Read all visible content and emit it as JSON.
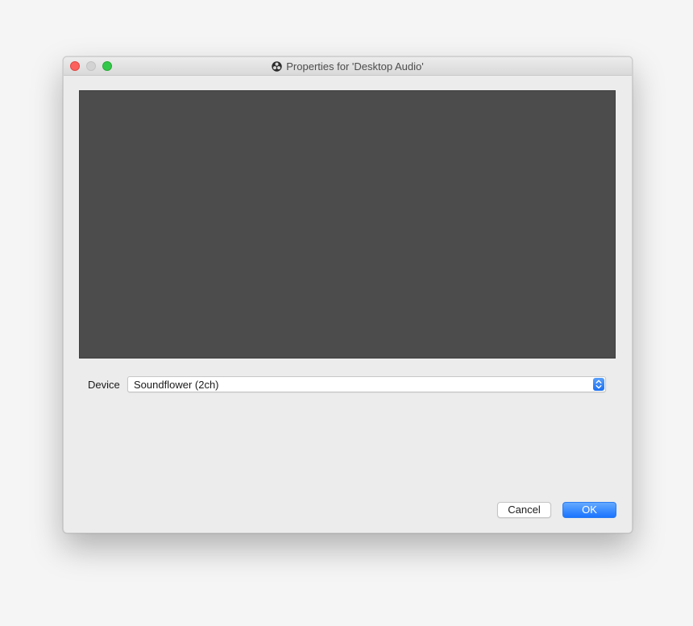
{
  "window": {
    "title": "Properties for 'Desktop Audio'",
    "title_icon": "obs-icon"
  },
  "preview": {
    "background_color": "#4c4c4c"
  },
  "device": {
    "label": "Device",
    "selected_value": "Soundflower (2ch)",
    "arrow_icon": "chevron-updown-icon"
  },
  "buttons": {
    "cancel_label": "Cancel",
    "ok_label": "OK"
  },
  "colors": {
    "accent": "#1a74ff",
    "close": "#fc615d",
    "minimize_disabled": "#d3d3d3",
    "zoom": "#34c84a"
  }
}
